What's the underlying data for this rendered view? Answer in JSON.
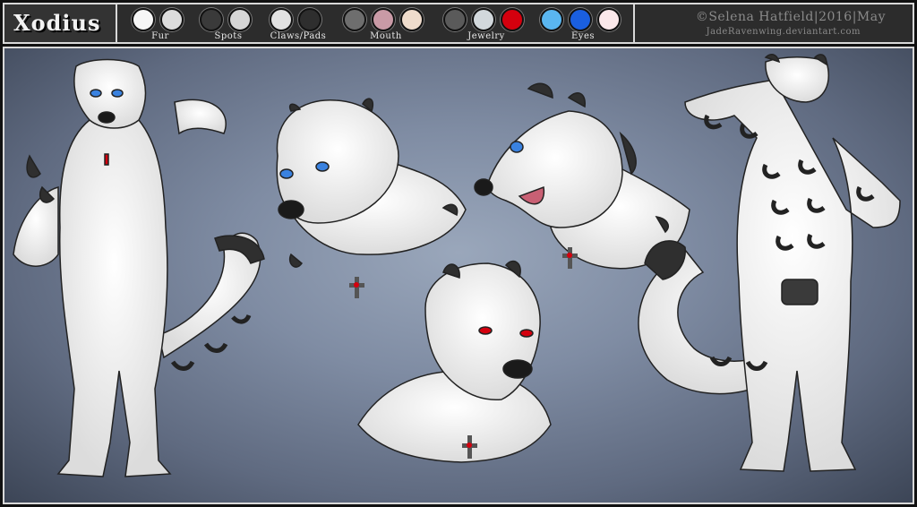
{
  "header": {
    "character_name": "Xodius",
    "credit_line_1": "©Selena Hatfield|2016|May",
    "credit_line_2": "JadeRavenwing.deviantart.com"
  },
  "palette": [
    {
      "label": "Fur",
      "colors": [
        "#f6f6f6",
        "#dcdcdc"
      ]
    },
    {
      "label": "Spots",
      "colors": [
        "#3a3a3a",
        "#d6d6d6"
      ]
    },
    {
      "label": "Claws/Pads",
      "colors": [
        "#e2e2e2",
        "#2e2e2e"
      ]
    },
    {
      "label": "Mouth",
      "colors": [
        "#6e6e6e",
        "#c99aa6",
        "#efdccc"
      ]
    },
    {
      "label": "Jewelry",
      "colors": [
        "#5a5a5a",
        "#d2d8dc",
        "#d4000e"
      ]
    },
    {
      "label": "Eyes",
      "colors": [
        "#5ab6f0",
        "#1a5fe0",
        "#fbe8ea"
      ]
    }
  ],
  "colors": {
    "background_dark": "#3c4556",
    "background_light": "#9aa7bb",
    "fur": "#f4f4f4",
    "spots": "#2f2f2f",
    "eye_blue": "#3a82e0",
    "eye_red": "#d4000e",
    "frame": "#d8d8d8"
  }
}
